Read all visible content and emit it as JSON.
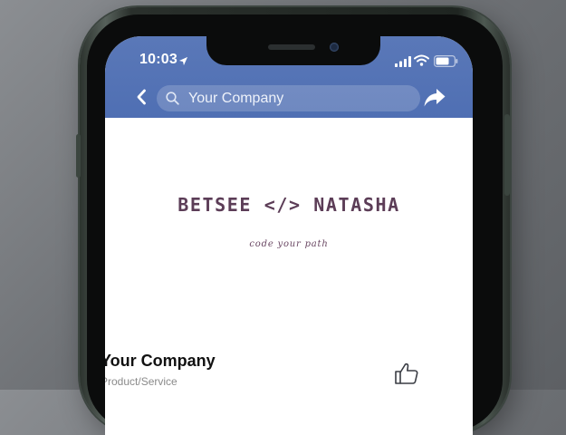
{
  "status_bar": {
    "time": "10:03"
  },
  "nav": {
    "search_text": "Your Company"
  },
  "cover": {
    "brand_title": "BETSEE </> NATASHA",
    "brand_subtitle": "code your path"
  },
  "page": {
    "name": "Your Company",
    "category": "Product/Service"
  },
  "colors": {
    "header_blue": "#5170b4",
    "brand_purple": "#5c3d57",
    "phone_frame": "#2a302c"
  },
  "icons": [
    "location-arrow-icon",
    "signal-icon",
    "wifi-icon",
    "battery-icon",
    "back-chevron-icon",
    "search-icon",
    "share-icon",
    "like-icon"
  ]
}
